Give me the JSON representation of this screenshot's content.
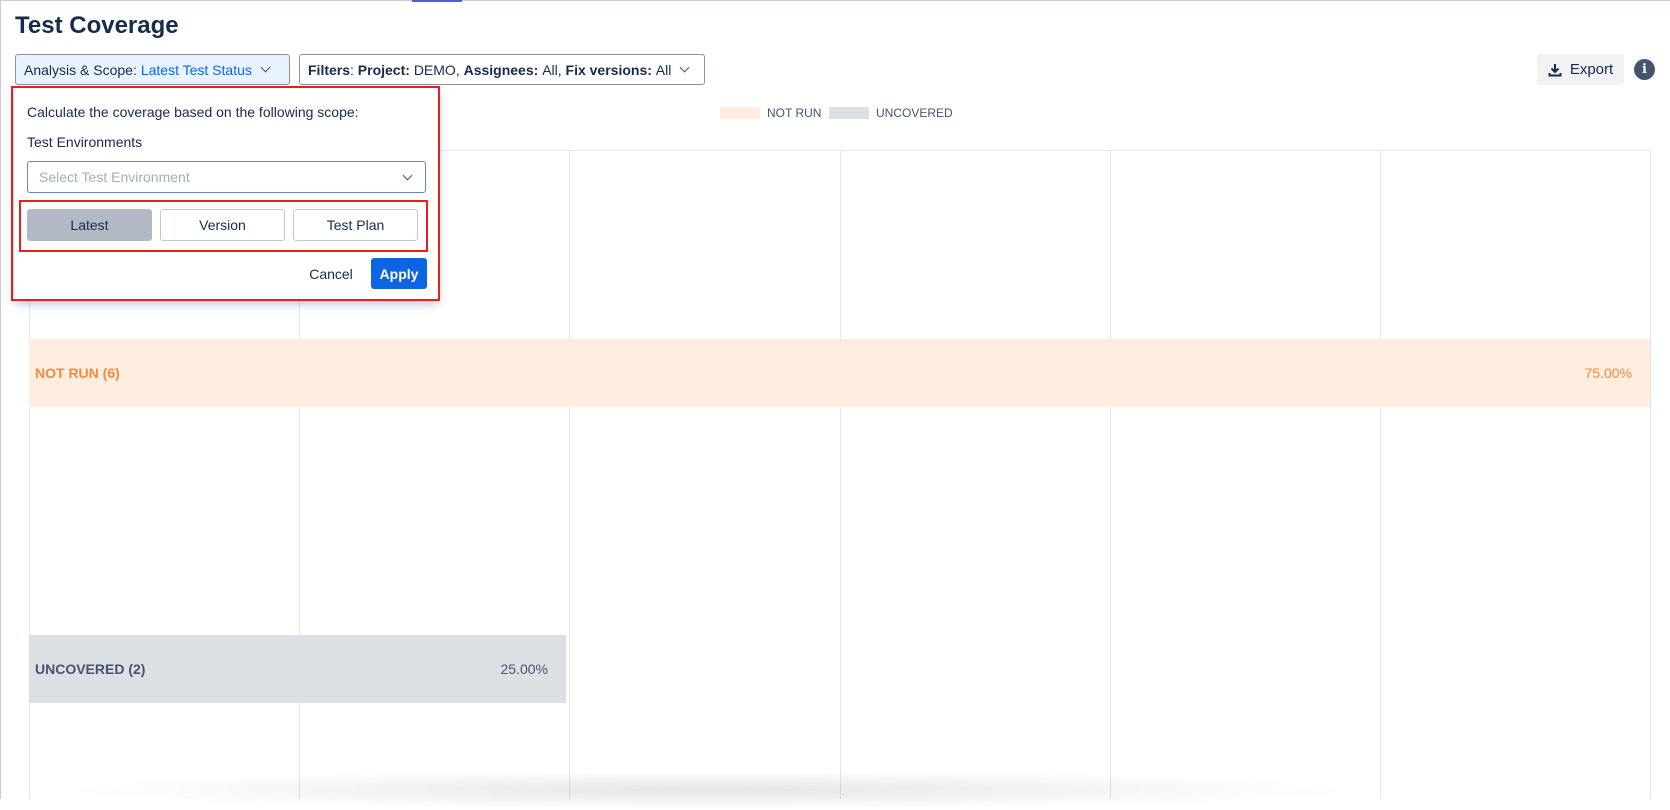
{
  "header": {
    "title": "Test Coverage",
    "scope_label": "Analysis & Scope:",
    "scope_value": "Latest Test Status",
    "filters": {
      "label": "Filters",
      "project_key": "Project:",
      "project_val": "DEMO,",
      "assignees_key": "Assignees:",
      "assignees_val": "All,",
      "fix_key": "Fix versions:",
      "fix_val": "All"
    },
    "export_label": "Export"
  },
  "legend": [
    {
      "label": "NOT RUN",
      "color": "#ffede0"
    },
    {
      "label": "UNCOVERED",
      "color": "#dcdfe4"
    }
  ],
  "chart_data": {
    "type": "bar",
    "categories": [
      "NOT RUN (6)",
      "UNCOVERED (2)"
    ],
    "values": [
      75.0,
      25.0
    ],
    "value_labels": [
      "75.00%",
      "25.00%"
    ],
    "colors": [
      "#ffede0",
      "#dcdfe4"
    ],
    "text_colors": [
      "#f38a3f",
      "#44546f"
    ],
    "xlim": [
      0,
      100
    ],
    "grid": true,
    "legend": "top"
  },
  "popover": {
    "intro": "Calculate the coverage based on the following scope:",
    "env_label": "Test Environments",
    "env_placeholder": "Select Test Environment",
    "modes": [
      "Latest",
      "Version",
      "Test Plan"
    ],
    "active_mode": "Latest",
    "cancel_label": "Cancel",
    "apply_label": "Apply"
  }
}
